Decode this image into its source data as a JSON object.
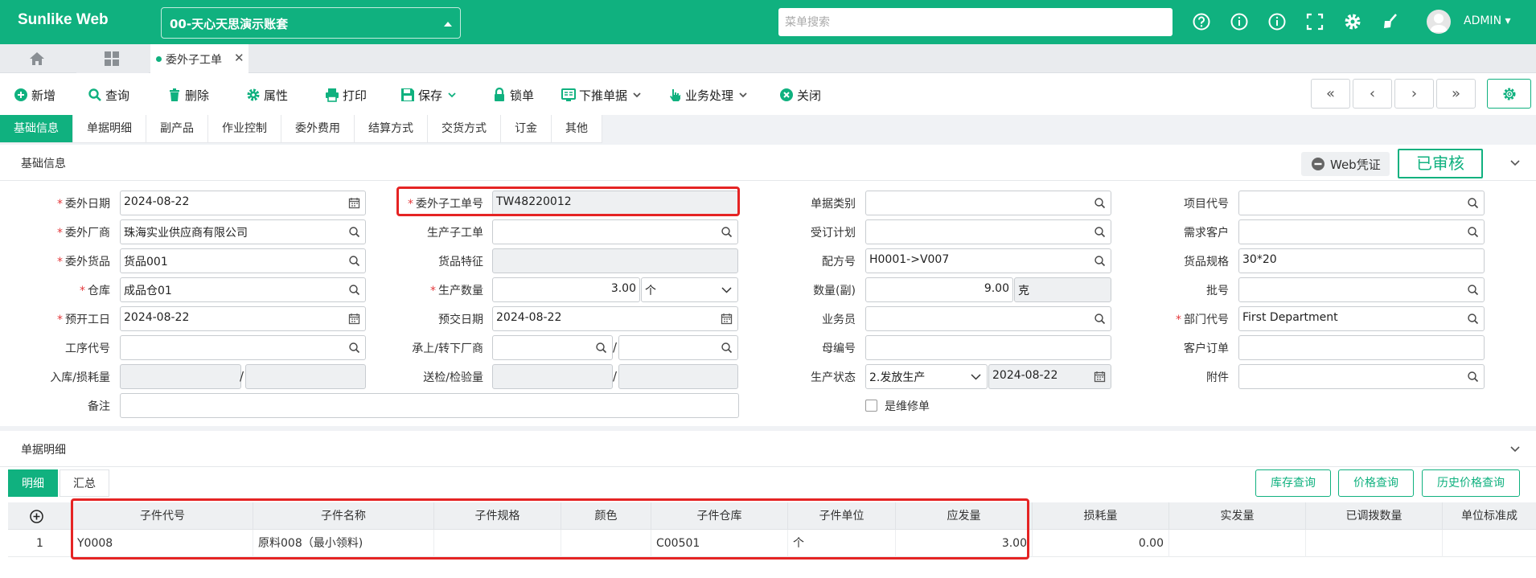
{
  "app": {
    "brand": "Sunlike Web",
    "account": "00-天心天思演示账套",
    "search_placeholder": "菜单搜索",
    "user": "ADMIN"
  },
  "tabs": [
    {
      "label": "委外子工单"
    }
  ],
  "toolbar": {
    "new": "新增",
    "query": "查询",
    "delete": "删除",
    "properties": "属性",
    "print": "打印",
    "save": "保存",
    "lock": "锁单",
    "push_down": "下推单据",
    "business": "业务处理",
    "close": "关闭"
  },
  "section_tabs": [
    "基础信息",
    "单据明细",
    "副产品",
    "作业控制",
    "委外费用",
    "结算方式",
    "交货方式",
    "订金",
    "其他"
  ],
  "basic": {
    "title": "基础信息",
    "web_voucher": "Web凭证",
    "audited": "已审核",
    "fields": {
      "outsource_date": {
        "label": "委外日期",
        "value": "2024-08-22"
      },
      "outsource_vendor": {
        "label": "委外厂商",
        "value": "珠海实业供应商有限公司"
      },
      "outsource_goods": {
        "label": "委外货品",
        "value": "货品001"
      },
      "warehouse": {
        "label": "仓库",
        "value": "成品仓01"
      },
      "plan_start": {
        "label": "预开工日",
        "value": "2024-08-22"
      },
      "process_code": {
        "label": "工序代号",
        "value": ""
      },
      "stock_in_loss": {
        "label": "入库/损耗量",
        "value": ""
      },
      "remark": {
        "label": "备注",
        "value": ""
      },
      "sub_order_no": {
        "label": "委外子工单号",
        "value": "TW48220012"
      },
      "prod_sub_order": {
        "label": "生产子工单",
        "value": ""
      },
      "goods_feature": {
        "label": "货品特征",
        "value": ""
      },
      "prod_qty": {
        "label": "生产数量",
        "value": "3.00",
        "unit": "个"
      },
      "plan_delivery": {
        "label": "预交日期",
        "value": "2024-08-22"
      },
      "up_down_vendor": {
        "label": "承上/转下厂商",
        "value": ""
      },
      "inspect_qty": {
        "label": "送检/检验量",
        "value": ""
      },
      "doc_type": {
        "label": "单据类别",
        "value": ""
      },
      "order_plan": {
        "label": "受订计划",
        "value": ""
      },
      "formula_no": {
        "label": "配方号",
        "value": "H0001->V007"
      },
      "qty_sub": {
        "label": "数量(副)",
        "value": "9.00",
        "unit": "克"
      },
      "salesman": {
        "label": "业务员",
        "value": ""
      },
      "parent_no": {
        "label": "母编号",
        "value": ""
      },
      "prod_status": {
        "label": "生产状态",
        "value": "2.发放生产",
        "date": "2024-08-22"
      },
      "is_repair": {
        "label": "是维修单"
      },
      "project_code": {
        "label": "项目代号",
        "value": ""
      },
      "demand_customer": {
        "label": "需求客户",
        "value": ""
      },
      "goods_spec": {
        "label": "货品规格",
        "value": "30*20"
      },
      "batch_no": {
        "label": "批号",
        "value": ""
      },
      "dept_code": {
        "label": "部门代号",
        "value": "First Department"
      },
      "customer_order": {
        "label": "客户订单",
        "value": ""
      },
      "attachment": {
        "label": "附件",
        "value": ""
      }
    }
  },
  "detail": {
    "title": "单据明细",
    "subtabs": [
      "明细",
      "汇总"
    ],
    "buttons": [
      "库存查询",
      "价格查询",
      "历史价格查询"
    ],
    "columns": [
      "子件代号",
      "子件名称",
      "子件规格",
      "颜色",
      "子件仓库",
      "子件单位",
      "应发量",
      "损耗量",
      "实发量",
      "已调拨数量",
      "单位标准成"
    ],
    "rows": [
      {
        "index": "1",
        "code": "Y0008",
        "name": "原料008（最小领料)",
        "spec": "",
        "color": "",
        "warehouse": "C00501",
        "unit": "个",
        "qty_due": "3.00",
        "loss": "0.00",
        "issued": "",
        "transferred": "",
        "std_cost": ""
      }
    ]
  }
}
